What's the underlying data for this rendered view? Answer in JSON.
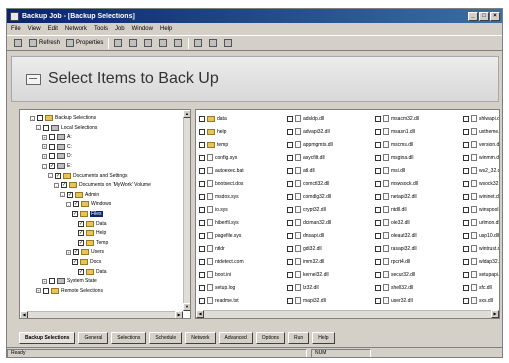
{
  "window": {
    "title": "Backup Job - [Backup Selections]",
    "min_label": "_",
    "max_label": "□",
    "close_label": "×"
  },
  "menu": [
    "File",
    "View",
    "Edit",
    "Network",
    "Tools",
    "Job",
    "Window",
    "Help"
  ],
  "toolbar": [
    {
      "label": "",
      "icon": "save-icon"
    },
    {
      "label": "Refresh",
      "icon": "refresh-icon"
    },
    {
      "label": "Properties",
      "icon": "properties-icon"
    },
    {
      "label": "",
      "icon": "cut-icon"
    },
    {
      "label": "",
      "icon": "copy-icon"
    },
    {
      "label": "",
      "icon": "paste-icon"
    },
    {
      "label": "",
      "icon": "delete-icon"
    },
    {
      "label": "",
      "icon": "select-icon"
    },
    {
      "label": "",
      "icon": "large-icons-icon"
    },
    {
      "label": "",
      "icon": "details-icon"
    },
    {
      "label": "",
      "icon": "help-icon"
    }
  ],
  "header": {
    "title": "Select Items to Back Up"
  },
  "tree": {
    "nodes": [
      {
        "label": "Backup Selections",
        "indent": 1,
        "expander": "-",
        "checked": false,
        "icon": "folder",
        "selected": false
      },
      {
        "label": "Local Selections",
        "indent": 2,
        "expander": "-",
        "checked": false,
        "icon": "drive",
        "selected": false
      },
      {
        "label": "A:",
        "indent": 3,
        "expander": "+",
        "checked": false,
        "icon": "drive",
        "selected": false
      },
      {
        "label": "C:",
        "indent": 3,
        "expander": "+",
        "checked": false,
        "icon": "drive",
        "selected": false
      },
      {
        "label": "D:",
        "indent": 3,
        "expander": "+",
        "checked": false,
        "icon": "drive",
        "selected": false
      },
      {
        "label": "E:",
        "indent": 3,
        "expander": "-",
        "checked": true,
        "icon": "drive",
        "selected": false
      },
      {
        "label": "Documents and Settings",
        "indent": 4,
        "expander": "-",
        "checked": true,
        "icon": "folder",
        "selected": false
      },
      {
        "label": "Documents on 'MyWork' Volume",
        "indent": 5,
        "expander": "-",
        "checked": true,
        "icon": "folder",
        "selected": false
      },
      {
        "label": "Admin",
        "indent": 6,
        "expander": "-",
        "checked": true,
        "icon": "folder",
        "selected": false
      },
      {
        "label": "Windows",
        "indent": 7,
        "expander": "-",
        "checked": true,
        "icon": "folder",
        "selected": false
      },
      {
        "label": "Files",
        "indent": 8,
        "expander": "",
        "checked": true,
        "icon": "folder",
        "selected": true
      },
      {
        "label": "Data",
        "indent": 9,
        "expander": "",
        "checked": true,
        "icon": "folder",
        "selected": false
      },
      {
        "label": "Help",
        "indent": 9,
        "expander": "",
        "checked": true,
        "icon": "folder",
        "selected": false
      },
      {
        "label": "Temp",
        "indent": 9,
        "expander": "",
        "checked": true,
        "icon": "folder",
        "selected": false
      },
      {
        "label": "Users",
        "indent": 7,
        "expander": "+",
        "checked": true,
        "icon": "folder",
        "selected": false
      },
      {
        "label": "Docs",
        "indent": 8,
        "expander": "",
        "checked": true,
        "icon": "folder",
        "selected": false
      },
      {
        "label": "Data",
        "indent": 9,
        "expander": "",
        "checked": true,
        "icon": "folder",
        "selected": false
      },
      {
        "label": "System State",
        "indent": 3,
        "expander": "+",
        "checked": false,
        "icon": "drive",
        "selected": false
      },
      {
        "label": "Remote Selections",
        "indent": 2,
        "expander": "+",
        "checked": false,
        "icon": "folder",
        "selected": false
      }
    ]
  },
  "files": {
    "columns": [
      [
        "data",
        "help",
        "temp",
        "config.sys",
        "autoexec.bat",
        "bootsect.dos",
        "msdos.sys",
        "io.sys",
        "hiberfil.sys",
        "pagefile.sys",
        "ntldr",
        "ntdetect.com",
        "boot.ini",
        "setup.log",
        "readme.txt"
      ],
      [
        "adsldp.dll",
        "advapi32.dll",
        "appmgmts.dll",
        "asycfilt.dll",
        "atl.dll",
        "comctl32.dll",
        "comdlg32.dll",
        "crypt32.dll",
        "dciman32.dll",
        "dnsapi.dll",
        "gdi32.dll",
        "imm32.dll",
        "kernel32.dll",
        "lz32.dll",
        "mapi32.dll"
      ],
      [
        "msacm32.dll",
        "msasn1.dll",
        "mscms.dll",
        "msgina.dll",
        "msi.dll",
        "mswsock.dll",
        "netapi32.dll",
        "ntdll.dll",
        "ole32.dll",
        "oleaut32.dll",
        "rasapi32.dll",
        "rpcrt4.dll",
        "secur32.dll",
        "shell32.dll",
        "user32.dll"
      ],
      [
        "shlwapi.dll",
        "uxtheme.dll",
        "version.dll",
        "winmm.dll",
        "ws2_32.dll",
        "wsock32.dll",
        "wininet.dll",
        "winspool.drv",
        "urlmon.dll",
        "usp10.dll",
        "wintrust.dll",
        "wldap32.dll",
        "setupapi.dll",
        "sfc.dll",
        "sxs.dll"
      ]
    ]
  },
  "tabs": [
    "Backup Selections",
    "General",
    "Selections",
    "Schedule",
    "Network",
    "Advanced",
    "Options",
    "Run",
    "Help"
  ],
  "status": {
    "left": "Ready",
    "right": "NUM"
  }
}
